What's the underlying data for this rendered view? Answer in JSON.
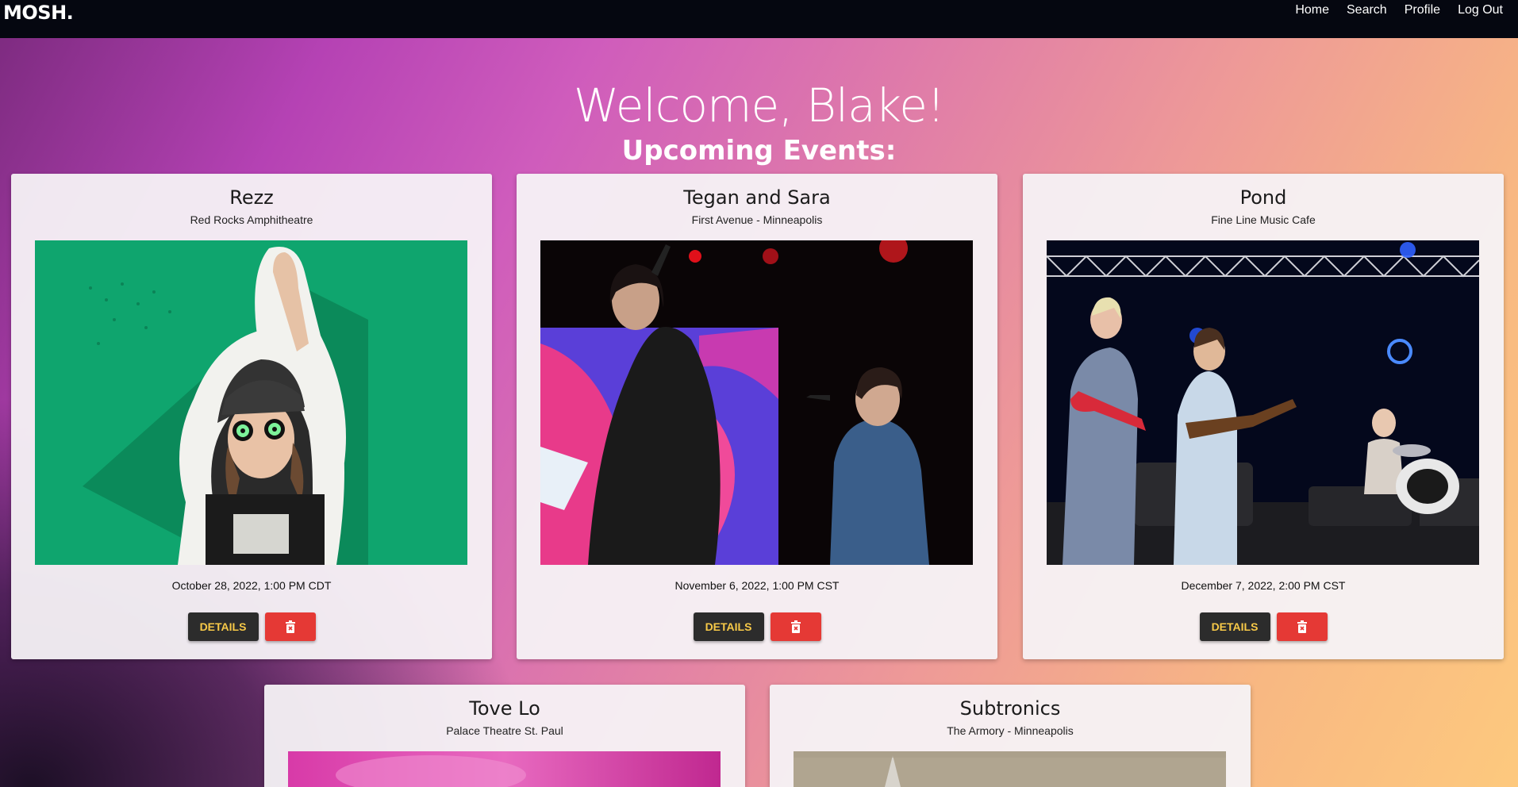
{
  "navbar": {
    "brand": "MOSH.",
    "links": [
      "Home",
      "Search",
      "Profile",
      "Log Out"
    ]
  },
  "header": {
    "welcome": "Welcome, Blake!",
    "subtitle": "Upcoming Events:"
  },
  "events": [
    {
      "title": "Rezz",
      "venue": "Red Rocks Amphitheatre",
      "date": "October 28, 2022, 1:00 PM CDT",
      "details_label": "DETAILS",
      "image": "rezz-photo"
    },
    {
      "title": "Tegan and Sara",
      "venue": "First Avenue - Minneapolis",
      "date": "November 6, 2022, 1:00 PM CST",
      "details_label": "DETAILS",
      "image": "tegan-and-sara-photo"
    },
    {
      "title": "Pond",
      "venue": "Fine Line Music Cafe",
      "date": "December 7, 2022, 2:00 PM CST",
      "details_label": "DETAILS",
      "image": "pond-photo"
    },
    {
      "title": "Tove Lo",
      "venue": "Palace Theatre St. Paul",
      "image": "tove-lo-photo"
    },
    {
      "title": "Subtronics",
      "venue": "The Armory - Minneapolis",
      "image": "subtronics-photo"
    }
  ],
  "colors": {
    "navbar": "#050710",
    "details_button": "#2c2c2c",
    "details_text": "#f7c948",
    "delete_button": "#e53935"
  }
}
